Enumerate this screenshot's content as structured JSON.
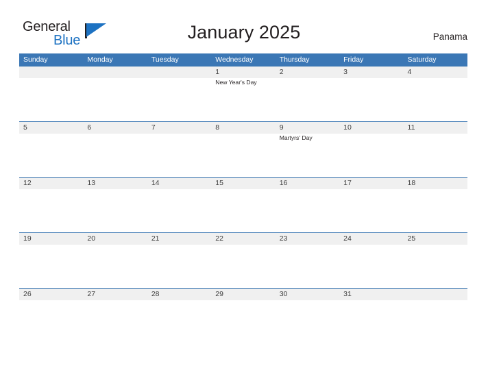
{
  "brand": {
    "name_part1": "General",
    "name_part2": "Blue",
    "flag_icon": "blue-flag-triangle",
    "color_dark": "#231f20",
    "color_blue": "#1d72c2"
  },
  "header": {
    "title": "January 2025",
    "country": "Panama"
  },
  "theme": {
    "header_blue": "#3b77b5",
    "row_divider_blue": "#2f6fae",
    "band_gray": "#f0f0f0",
    "text_dark": "#231f20"
  },
  "calendar": {
    "month": "January",
    "year": "2025",
    "weekday_headers": [
      "Sunday",
      "Monday",
      "Tuesday",
      "Wednesday",
      "Thursday",
      "Friday",
      "Saturday"
    ],
    "weeks": [
      [
        {
          "day": "",
          "event": ""
        },
        {
          "day": "",
          "event": ""
        },
        {
          "day": "",
          "event": ""
        },
        {
          "day": "1",
          "event": "New Year's Day"
        },
        {
          "day": "2",
          "event": ""
        },
        {
          "day": "3",
          "event": ""
        },
        {
          "day": "4",
          "event": ""
        }
      ],
      [
        {
          "day": "5",
          "event": ""
        },
        {
          "day": "6",
          "event": ""
        },
        {
          "day": "7",
          "event": ""
        },
        {
          "day": "8",
          "event": ""
        },
        {
          "day": "9",
          "event": "Martyrs' Day"
        },
        {
          "day": "10",
          "event": ""
        },
        {
          "day": "11",
          "event": ""
        }
      ],
      [
        {
          "day": "12",
          "event": ""
        },
        {
          "day": "13",
          "event": ""
        },
        {
          "day": "14",
          "event": ""
        },
        {
          "day": "15",
          "event": ""
        },
        {
          "day": "16",
          "event": ""
        },
        {
          "day": "17",
          "event": ""
        },
        {
          "day": "18",
          "event": ""
        }
      ],
      [
        {
          "day": "19",
          "event": ""
        },
        {
          "day": "20",
          "event": ""
        },
        {
          "day": "21",
          "event": ""
        },
        {
          "day": "22",
          "event": ""
        },
        {
          "day": "23",
          "event": ""
        },
        {
          "day": "24",
          "event": ""
        },
        {
          "day": "25",
          "event": ""
        }
      ],
      [
        {
          "day": "26",
          "event": ""
        },
        {
          "day": "27",
          "event": ""
        },
        {
          "day": "28",
          "event": ""
        },
        {
          "day": "29",
          "event": ""
        },
        {
          "day": "30",
          "event": ""
        },
        {
          "day": "31",
          "event": ""
        },
        {
          "day": "",
          "event": ""
        }
      ]
    ]
  }
}
